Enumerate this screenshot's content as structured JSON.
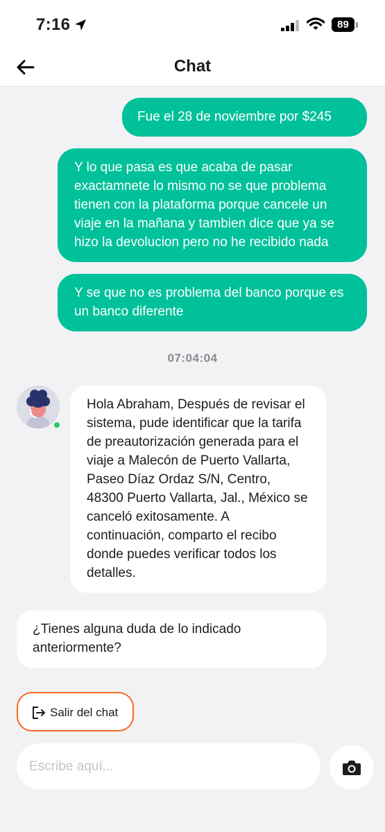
{
  "status_bar": {
    "time": "7:16",
    "battery": "89"
  },
  "header": {
    "title": "Chat"
  },
  "messages": [
    {
      "from": "user",
      "text": "Fue el 28 de noviembre por $245"
    },
    {
      "from": "user",
      "text": "Y lo que pasa es que acaba de pasar exactamnete lo mismo no se que problema tienen con la plataforma porque cancele un viaje en la mañana y tambien dice que ya se hizo la devolucion pero no he recibido nada"
    },
    {
      "from": "user",
      "text": "Y se que no es problema del banco porque es un banco diferente"
    },
    {
      "from": "agent",
      "text": "Hola Abraham, Después de revisar el sistema, pude identificar que la tarifa de preautorización generada para el viaje a Malecón de Puerto Vallarta, Paseo Díaz Ordaz S/N, Centro, 48300 Puerto Vallarta, Jal., México se canceló exitosamente. A continuación, comparto el recibo donde puedes verificar todos los detalles."
    },
    {
      "from": "agent",
      "text": "¿Tienes alguna duda de lo indicado anteriormente?"
    }
  ],
  "timestamp": "07:04:04",
  "exit_chat": {
    "label": "Salir del chat"
  },
  "composer": {
    "placeholder": "Escribe aquí...",
    "value": ""
  },
  "colors": {
    "outgoing_bubble": "#00c19a",
    "incoming_bubble": "#ffffff",
    "background": "#f2f2f5",
    "exit_border": "#f26a22",
    "online": "#2fc46b"
  },
  "icons": {
    "back": "arrow-left-icon",
    "location": "location-arrow-icon",
    "signal": "cellular-signal-icon",
    "wifi": "wifi-icon",
    "exit": "exit-door-icon",
    "camera": "camera-icon"
  }
}
